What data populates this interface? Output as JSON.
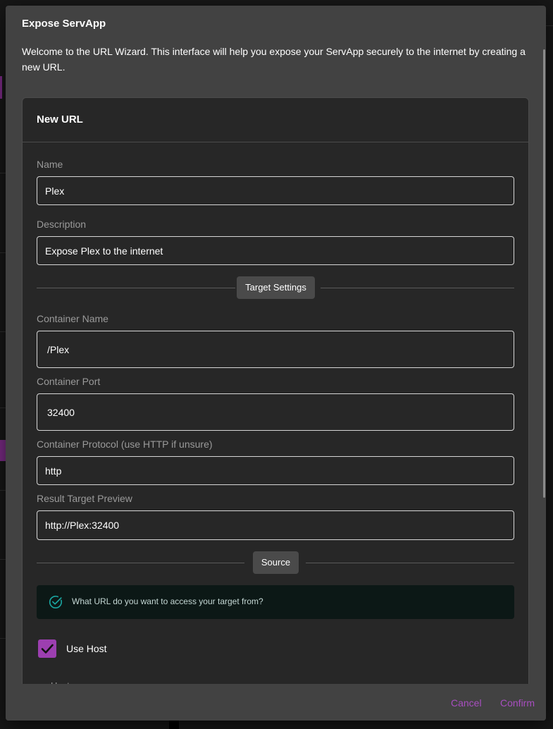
{
  "dialog": {
    "title": "Expose ServApp",
    "intro": "Welcome to the URL Wizard. This interface will help you expose your ServApp securely to the internet by creating a new URL."
  },
  "card": {
    "title": "New URL"
  },
  "form": {
    "name": {
      "label": "Name",
      "value": "Plex"
    },
    "description": {
      "label": "Description",
      "value": "Expose Plex to the internet"
    },
    "target_section": "Target Settings",
    "container_name": {
      "label": "Container Name",
      "value": "/Plex"
    },
    "container_port": {
      "label": "Container Port",
      "value": "32400"
    },
    "container_protocol": {
      "label": "Container Protocol (use HTTP if unsure)",
      "value": "http"
    },
    "result_preview": {
      "label": "Result Target Preview",
      "value": "http://Plex:32400"
    },
    "source_section": "Source",
    "info_text": "What URL do you want to access your target from?",
    "use_host": {
      "label": "Use Host",
      "checked": true
    },
    "host": {
      "label": "Host"
    }
  },
  "footer": {
    "cancel": "Cancel",
    "confirm": "Confirm"
  },
  "colors": {
    "accent": "#9c3fb0",
    "info_icon": "#1aa5a0",
    "dialog_bg": "#424242",
    "card_bg": "#272727"
  },
  "icons": {
    "info": "check-circle-icon",
    "checkbox": "checkmark-icon"
  }
}
